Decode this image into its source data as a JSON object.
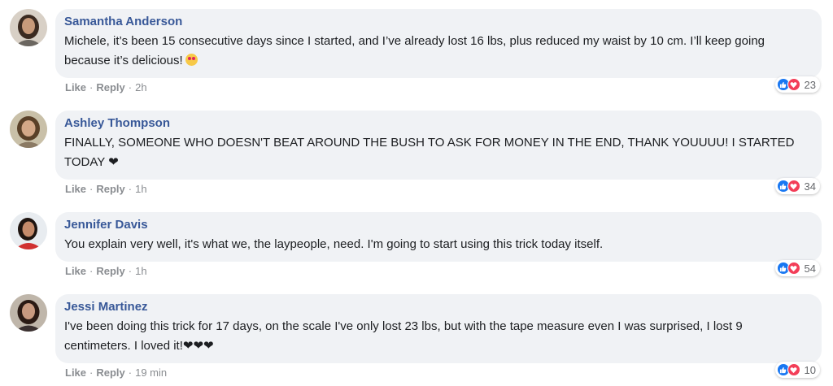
{
  "comments": [
    {
      "name": "Samantha Anderson",
      "lines": [
        "Michele, it’s been 15 consecutive days since I started, and I’ve already lost 16 lbs, plus reduced my waist by 10 cm. I’ll keep going",
        "because it’s delicious!"
      ],
      "emoji": "heart-eyes-emoji",
      "like": "Like",
      "reply": "Reply",
      "time": "2h",
      "reactions": "23",
      "avatar_colors": {
        "bg": "#d8d0c6",
        "hair": "#3b2a20",
        "skin": "#c89a7a"
      }
    },
    {
      "name": "Ashley Thompson",
      "lines": [
        "FINALLY, SOMEONE WHO DOESN'T BEAT AROUND THE BUSH TO ASK FOR MONEY IN THE END, THANK YOUUUU! I STARTED",
        "TODAY ❤"
      ],
      "like": "Like",
      "reply": "Reply",
      "time": "1h",
      "reactions": "34",
      "avatar_colors": {
        "bg": "#c9c0a8",
        "hair": "#5a4028",
        "skin": "#d4a888"
      }
    },
    {
      "name": "Jennifer Davis",
      "lines": [
        "You explain very well, it's what we, the laypeople, need. I'm going to start using this trick today itself."
      ],
      "like": "Like",
      "reply": "Reply",
      "time": "1h",
      "reactions": "54",
      "avatar_colors": {
        "bg": "#e8ecf0",
        "hair": "#1e1410",
        "skin": "#c48a6a"
      }
    },
    {
      "name": "Jessi Martinez",
      "lines": [
        "I've been doing this trick for 17 days, on the scale I've only lost 23 lbs, but with the tape measure even I was surprised, I lost 9",
        "centimeters. I loved it!❤❤❤"
      ],
      "like": "Like",
      "reply": "Reply",
      "time": "19 min",
      "reactions": "10",
      "avatar_colors": {
        "bg": "#bfb6aa",
        "hair": "#2a1a14",
        "skin": "#c89a80"
      }
    }
  ],
  "colors": {
    "name": "#385898",
    "bubble": "#f0f2f5",
    "like_reaction": "#1877f2",
    "love_reaction": "#f33e58"
  },
  "icons": {
    "like_reaction": "thumbs-up-icon",
    "love_reaction": "heart-icon"
  }
}
